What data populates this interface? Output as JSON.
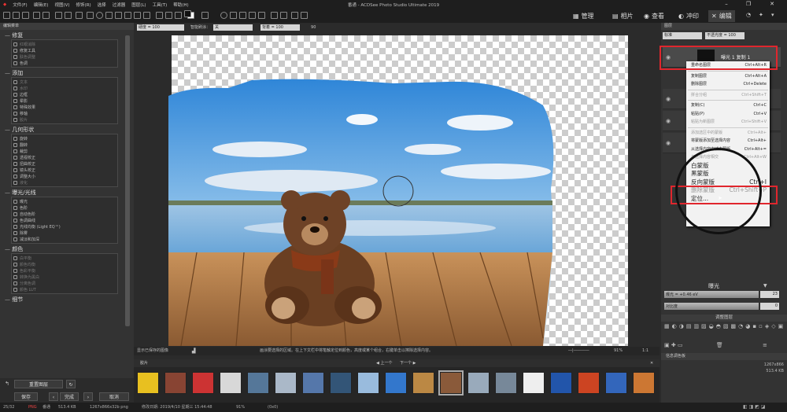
{
  "titlebar": {
    "title": "番通 - ACDSee Photo Studio Ultimate 2019",
    "menus": [
      "文件(F)",
      "编辑(E)",
      "视图(V)",
      "修饰(R)",
      "选择",
      "过滤器",
      "图层(L)",
      "工具(T)",
      "帮助(H)"
    ]
  },
  "modes": [
    {
      "label": "管理",
      "icon": "grid-icon"
    },
    {
      "label": "相片",
      "icon": "photo-icon"
    },
    {
      "label": "查看",
      "icon": "eye-icon"
    },
    {
      "label": "冲印",
      "icon": "develop-icon"
    },
    {
      "label": "编辑",
      "icon": "edit-icon"
    }
  ],
  "options_bar": {
    "hardness_label": "硬度 = 100",
    "smart_erase_label": "智能刷涂：",
    "smart_erase_value": "关",
    "flow_label": "背着 = 100",
    "angle_label": "90"
  },
  "left_panel": {
    "header": "编辑菜单",
    "sections": [
      {
        "title": "修复",
        "items": [
          {
            "label": "红眼消除",
            "dim": true
          },
          {
            "label": "修复工具",
            "dim": false
          },
          {
            "label": "肤色调整",
            "dim": true
          },
          {
            "label": "色调",
            "dim": false
          }
        ]
      },
      {
        "title": "添加",
        "items": [
          {
            "label": "文本",
            "dim": true
          },
          {
            "label": "水印",
            "dim": true
          },
          {
            "label": "边框",
            "dim": false
          },
          {
            "label": "晕影",
            "dim": false
          },
          {
            "label": "特殊效果",
            "dim": false
          },
          {
            "label": "移轴",
            "dim": false
          },
          {
            "label": "胶片",
            "dim": true
          }
        ]
      },
      {
        "title": "几何形状",
        "items": [
          {
            "label": "旋转",
            "dim": false
          },
          {
            "label": "翻转",
            "dim": false
          },
          {
            "label": "裁剪",
            "dim": false
          },
          {
            "label": "透视校正",
            "dim": false
          },
          {
            "label": "扭曲校正",
            "dim": false
          },
          {
            "label": "镜头校正",
            "dim": false
          },
          {
            "label": "调整大小",
            "dim": false
          },
          {
            "label": "液化",
            "dim": true
          }
        ]
      },
      {
        "title": "曝光/光线",
        "items": [
          {
            "label": "曝光",
            "dim": false
          },
          {
            "label": "色阶",
            "dim": false
          },
          {
            "label": "自动色阶",
            "dim": false
          },
          {
            "label": "色调曲线",
            "dim": false
          },
          {
            "label": "光线均衡 (Light EQ™)",
            "dim": false
          },
          {
            "label": "除雾",
            "dim": false
          },
          {
            "label": "减淡和加深",
            "dim": false
          }
        ]
      },
      {
        "title": "颜色",
        "items": [
          {
            "label": "白平衡",
            "dim": true
          },
          {
            "label": "颜色均衡",
            "dim": true
          },
          {
            "label": "色彩平衡",
            "dim": true
          },
          {
            "label": "转换为黑白",
            "dim": true
          },
          {
            "label": "分离色调",
            "dim": true
          },
          {
            "label": "颜色 LUT",
            "dim": true
          }
        ]
      },
      {
        "title": "细节",
        "items": []
      }
    ],
    "reset_label": "重置图层",
    "save_label": "保存",
    "done_label": "完成",
    "cancel_label": "取消"
  },
  "status_row": {
    "left_text": "显示已保存的图像",
    "hint": "画涂要选择的区域。在上下文栏中将笔触定位到颜色，高度或某个组合，右键单击以擦除选择内容。",
    "zoom": "91%",
    "ratio": "1:1"
  },
  "filmstrip": {
    "tab": "胶片",
    "prev": "上一个",
    "next": "下一个",
    "thumb_colors": [
      "#e8c020",
      "#884433",
      "#cc3333",
      "#d8d8d8",
      "#557799",
      "#aab8c8",
      "#5577aa",
      "#335577",
      "#99bbdd",
      "#3377cc",
      "#bb8844",
      "#8a5a3a",
      "#99aabb",
      "#778899",
      "#eeeeee",
      "#2255aa",
      "#cc4422",
      "#3366bb",
      "#cc7733"
    ],
    "selected_index": 11
  },
  "bottom_status": {
    "count": "25/32",
    "format": "PNG",
    "name": "番通",
    "size": "513.4 KB",
    "dims": "1267x866x32b png",
    "modified": "修改日期: 2019/4/10 星期三 15:44:48",
    "zoom": "91%",
    "coords": "(0x0)"
  },
  "right_panel": {
    "header": "图层",
    "blend_mode": "标准",
    "opacity_label": "不透光度 = 100",
    "layer_name": "曝光 1 复制 1",
    "context_menu": [
      {
        "label": "重命名图层",
        "shortcut": "Ctrl+Alt+R",
        "dim": false,
        "big": false
      },
      {
        "sep": true
      },
      {
        "label": "复制图层",
        "shortcut": "Ctrl+Alt+A",
        "dim": false,
        "big": false
      },
      {
        "label": "删除图层",
        "shortcut": "Ctrl+Delete",
        "dim": false,
        "big": false
      },
      {
        "sep": true
      },
      {
        "label": "拼合分组",
        "shortcut": "Ctrl+Shift+T",
        "dim": true,
        "big": false
      },
      {
        "sep": true
      },
      {
        "label": "复制(C)",
        "shortcut": "Ctrl+C",
        "dim": false,
        "big": false
      },
      {
        "label": "粘贴(P)",
        "shortcut": "Ctrl+V",
        "dim": false,
        "big": false
      },
      {
        "label": "粘贴为新图层",
        "shortcut": "Ctrl+Shift+V",
        "dim": true,
        "big": false
      },
      {
        "sep": true
      },
      {
        "label": "添加选区中的蒙版",
        "shortcut": "Ctrl+Alt+",
        "dim": true,
        "big": false
      },
      {
        "label": "将蒙版添加至选择内容",
        "shortcut": "Ctrl+Alt+",
        "dim": false,
        "big": false
      },
      {
        "label": "从选择内容中减去蒙版",
        "shortcut": "Ctrl+Alt+=",
        "dim": false,
        "big": false
      },
      {
        "label": "与选择内容相交",
        "shortcut": "Ctrl+Alt+W",
        "dim": true,
        "big": false
      },
      {
        "label": "白蒙版",
        "shortcut": "",
        "dim": false,
        "big": true
      },
      {
        "label": "黑蒙版",
        "shortcut": "",
        "dim": false,
        "big": true
      },
      {
        "label": "反向蒙版",
        "shortcut": "Ctrl+I",
        "dim": false,
        "big": true
      },
      {
        "label": "删除蒙版",
        "shortcut": "Ctrl+Shift+P",
        "dim": true,
        "big": true
      },
      {
        "label": "定位...",
        "shortcut": "",
        "dim": false,
        "big": true
      }
    ],
    "exposure_title": "曝光",
    "exposure_label": "曝光 = +0.46 eV",
    "exposure_value": "23",
    "contrast_label": "对比度",
    "contrast_value": "0",
    "adjust_title": "调整图层",
    "info_title": "信息调色板",
    "info_rows": [
      [
        "",
        "1267x866"
      ],
      [
        "",
        "513.4 KB"
      ]
    ]
  }
}
